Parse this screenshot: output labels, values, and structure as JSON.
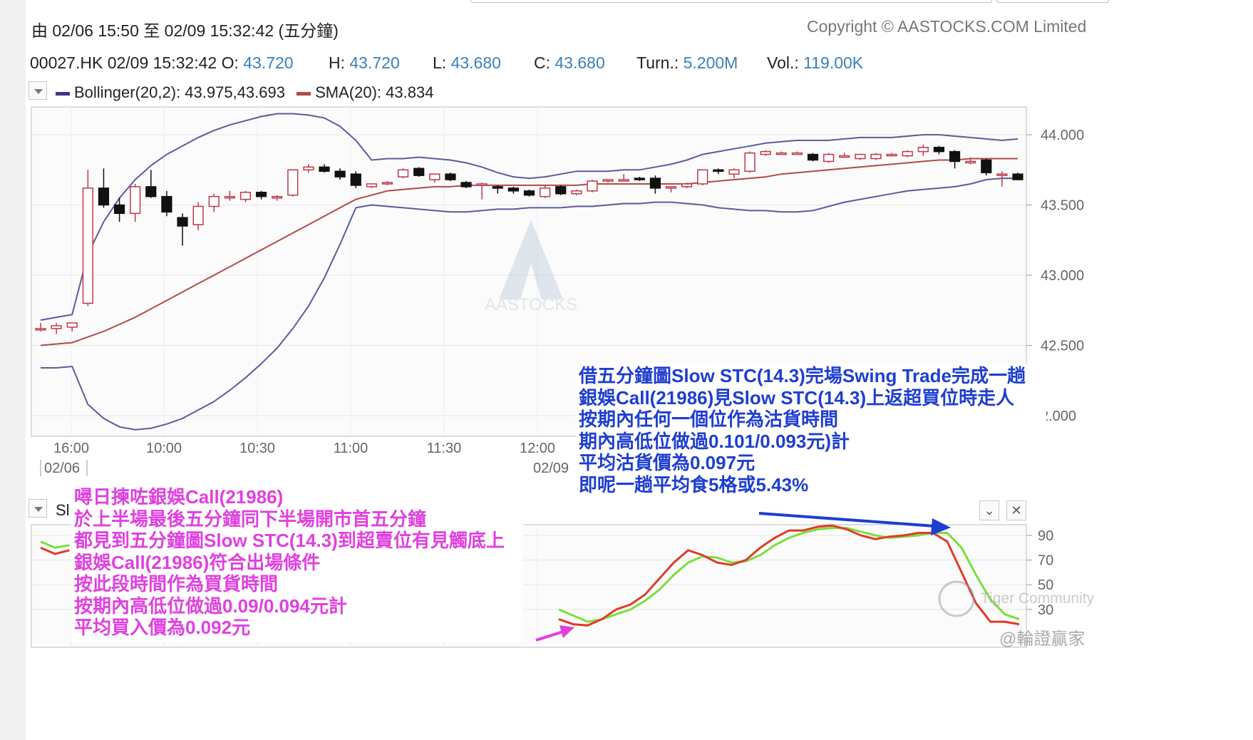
{
  "header": {
    "period": "由  02/06 15:50 至  02/09 15:32:42 (五分鐘)",
    "copyright": "Copyright © AASTOCKS.COM Limited"
  },
  "quote": {
    "symbol_time": "00027.HK 02/09 15:32:42",
    "o_label": "O:",
    "o_value": "43.720",
    "h_label": "H:",
    "h_value": "43.720",
    "l_label": "L:",
    "l_value": "43.680",
    "c_label": "C:",
    "c_value": "43.680",
    "turn_label": "Turn.:",
    "turn_value": "5.200M",
    "vol_label": "Vol.:",
    "vol_value": "119.00K"
  },
  "legend": {
    "bollinger": "Bollinger(20,2): 43.975,43.693",
    "sma": "SMA(20): 43.834"
  },
  "lower_panel": {
    "label_partial": "Sl"
  },
  "watermark": {
    "logo_text": "AASTOCKS",
    "tiger": "Tiger Community",
    "signature": "@輪證贏家"
  },
  "colors": {
    "bollinger": "#5b5b9e",
    "sma": "#b24a4a",
    "candle_up": "#c0384a",
    "candle_down": "#111111",
    "stc_k": "#e03a2a",
    "stc_d": "#7be03a",
    "annot_blue": "#1e3ecf",
    "annot_pink": "#e040e0",
    "arrow_blue": "#1e3ecf",
    "arrow_pink": "#e040e0"
  },
  "annotations": {
    "blue": [
      "借五分鐘圖Slow STC(14.3)完場Swing Trade完成一趟",
      "銀娛Call(21986)見Slow STC(14.3)上返超買位時走人",
      "按期內任何一個位作為沽貨時間",
      "期內高低位做過0.101/0.093元)計",
      "平均沽貨價為0.097元",
      "即呢一趟平均食5格或5.43%"
    ],
    "pink": [
      "噚日揀咗銀娛Call(21986)",
      "於上半場最後五分鐘同下半場開市首五分鐘",
      "都見到五分鐘圖Slow STC(14.3)到超賣位有見觸底上",
      "銀娛Call(21986)符合出場條件",
      "按此段時間作為買貨時間",
      "按期內高低位做過0.09/0.094元計",
      "平均買入價為0.092元"
    ]
  },
  "chart_data": [
    {
      "type": "candlestick",
      "title": "",
      "y_ticks": [
        "44.000",
        "43.500",
        "43.000",
        "42.500",
        "2.000"
      ],
      "ylim": [
        42.0,
        44.2
      ],
      "x_ticks": [
        "16:00",
        "10:00",
        "10:30",
        "11:00",
        "11:30",
        "12:00"
      ],
      "date_labels": [
        "02/06",
        "02/09"
      ],
      "grid": true,
      "candles": [
        {
          "o": 42.62,
          "h": 42.66,
          "l": 42.6,
          "c": 42.62
        },
        {
          "o": 42.62,
          "h": 42.66,
          "l": 42.58,
          "c": 42.64
        },
        {
          "o": 42.63,
          "h": 42.66,
          "l": 42.6,
          "c": 42.66
        },
        {
          "o": 42.8,
          "h": 43.75,
          "l": 42.78,
          "c": 43.62
        },
        {
          "o": 43.62,
          "h": 43.76,
          "l": 43.48,
          "c": 43.5
        },
        {
          "o": 43.5,
          "h": 43.55,
          "l": 43.38,
          "c": 43.44
        },
        {
          "o": 43.44,
          "h": 43.65,
          "l": 43.38,
          "c": 43.63
        },
        {
          "o": 43.63,
          "h": 43.75,
          "l": 43.55,
          "c": 43.56
        },
        {
          "o": 43.56,
          "h": 43.6,
          "l": 43.42,
          "c": 43.45
        },
        {
          "o": 43.41,
          "h": 43.44,
          "l": 43.21,
          "c": 43.35
        },
        {
          "o": 43.36,
          "h": 43.52,
          "l": 43.32,
          "c": 43.49
        },
        {
          "o": 43.49,
          "h": 43.58,
          "l": 43.45,
          "c": 43.56
        },
        {
          "o": 43.56,
          "h": 43.6,
          "l": 43.53,
          "c": 43.56
        },
        {
          "o": 43.54,
          "h": 43.6,
          "l": 43.52,
          "c": 43.59
        },
        {
          "o": 43.59,
          "h": 43.6,
          "l": 43.54,
          "c": 43.56
        },
        {
          "o": 43.56,
          "h": 43.57,
          "l": 43.53,
          "c": 43.56
        },
        {
          "o": 43.57,
          "h": 43.75,
          "l": 43.56,
          "c": 43.75
        },
        {
          "o": 43.75,
          "h": 43.79,
          "l": 43.73,
          "c": 43.77
        },
        {
          "o": 43.77,
          "h": 43.79,
          "l": 43.73,
          "c": 43.74
        },
        {
          "o": 43.74,
          "h": 43.76,
          "l": 43.68,
          "c": 43.7
        },
        {
          "o": 43.72,
          "h": 43.74,
          "l": 43.62,
          "c": 43.64
        },
        {
          "o": 43.63,
          "h": 43.65,
          "l": 43.62,
          "c": 43.65
        },
        {
          "o": 43.66,
          "h": 43.67,
          "l": 43.64,
          "c": 43.66
        },
        {
          "o": 43.7,
          "h": 43.76,
          "l": 43.69,
          "c": 43.75
        },
        {
          "o": 43.76,
          "h": 43.77,
          "l": 43.7,
          "c": 43.71
        },
        {
          "o": 43.68,
          "h": 43.72,
          "l": 43.66,
          "c": 43.72
        },
        {
          "o": 43.72,
          "h": 43.73,
          "l": 43.67,
          "c": 43.68
        },
        {
          "o": 43.66,
          "h": 43.67,
          "l": 43.62,
          "c": 43.63
        },
        {
          "o": 43.64,
          "h": 43.66,
          "l": 43.54,
          "c": 43.65
        },
        {
          "o": 43.63,
          "h": 43.64,
          "l": 43.58,
          "c": 43.62
        },
        {
          "o": 43.62,
          "h": 43.63,
          "l": 43.58,
          "c": 43.6
        },
        {
          "o": 43.6,
          "h": 43.61,
          "l": 43.56,
          "c": 43.57
        },
        {
          "o": 43.56,
          "h": 43.64,
          "l": 43.55,
          "c": 43.62
        },
        {
          "o": 43.63,
          "h": 43.64,
          "l": 43.57,
          "c": 43.58
        },
        {
          "o": 43.58,
          "h": 43.61,
          "l": 43.57,
          "c": 43.6
        },
        {
          "o": 43.6,
          "h": 43.68,
          "l": 43.59,
          "c": 43.67
        },
        {
          "o": 43.67,
          "h": 43.68,
          "l": 43.66,
          "c": 43.68
        },
        {
          "o": 43.68,
          "h": 43.72,
          "l": 43.67,
          "c": 43.68
        },
        {
          "o": 43.69,
          "h": 43.7,
          "l": 43.67,
          "c": 43.68
        },
        {
          "o": 43.69,
          "h": 43.71,
          "l": 43.58,
          "c": 43.62
        },
        {
          "o": 43.62,
          "h": 43.63,
          "l": 43.59,
          "c": 43.63
        },
        {
          "o": 43.63,
          "h": 43.66,
          "l": 43.62,
          "c": 43.65
        },
        {
          "o": 43.65,
          "h": 43.75,
          "l": 43.64,
          "c": 43.75
        },
        {
          "o": 43.75,
          "h": 43.76,
          "l": 43.72,
          "c": 43.74
        },
        {
          "o": 43.72,
          "h": 43.76,
          "l": 43.69,
          "c": 43.75
        },
        {
          "o": 43.74,
          "h": 43.88,
          "l": 43.73,
          "c": 43.87
        },
        {
          "o": 43.86,
          "h": 43.89,
          "l": 43.85,
          "c": 43.88
        },
        {
          "o": 43.87,
          "h": 43.88,
          "l": 43.86,
          "c": 43.87
        },
        {
          "o": 43.87,
          "h": 43.88,
          "l": 43.86,
          "c": 43.87
        },
        {
          "o": 43.86,
          "h": 43.87,
          "l": 43.81,
          "c": 43.82
        },
        {
          "o": 43.81,
          "h": 43.87,
          "l": 43.8,
          "c": 43.86
        },
        {
          "o": 43.85,
          "h": 43.87,
          "l": 43.84,
          "c": 43.85
        },
        {
          "o": 43.83,
          "h": 43.86,
          "l": 43.82,
          "c": 43.86
        },
        {
          "o": 43.83,
          "h": 43.87,
          "l": 43.82,
          "c": 43.86
        },
        {
          "o": 43.86,
          "h": 43.87,
          "l": 43.85,
          "c": 43.86
        },
        {
          "o": 43.85,
          "h": 43.89,
          "l": 43.84,
          "c": 43.88
        },
        {
          "o": 43.88,
          "h": 43.93,
          "l": 43.85,
          "c": 43.91
        },
        {
          "o": 43.91,
          "h": 43.92,
          "l": 43.86,
          "c": 43.88
        },
        {
          "o": 43.88,
          "h": 43.89,
          "l": 43.76,
          "c": 43.81
        },
        {
          "o": 43.8,
          "h": 43.84,
          "l": 43.79,
          "c": 43.81
        },
        {
          "o": 43.82,
          "h": 43.83,
          "l": 43.71,
          "c": 43.73
        },
        {
          "o": 43.72,
          "h": 43.74,
          "l": 43.63,
          "c": 43.72
        },
        {
          "o": 43.72,
          "h": 43.73,
          "l": 43.68,
          "c": 43.68
        }
      ],
      "bollinger_upper": [
        42.68,
        42.7,
        42.72,
        43.15,
        43.38,
        43.55,
        43.68,
        43.78,
        43.86,
        43.92,
        43.98,
        44.03,
        44.07,
        44.1,
        44.13,
        44.15,
        44.15,
        44.14,
        44.12,
        44.06,
        43.96,
        43.82,
        43.83,
        43.83,
        43.84,
        43.83,
        43.82,
        43.8,
        43.77,
        43.73,
        43.7,
        43.69,
        43.7,
        43.72,
        43.74,
        43.74,
        43.74,
        43.75,
        43.75,
        43.77,
        43.79,
        43.82,
        43.86,
        43.88,
        43.9,
        43.92,
        43.94,
        43.95,
        43.96,
        43.96,
        43.96,
        43.97,
        43.98,
        43.98,
        43.98,
        43.99,
        44.0,
        44.0,
        43.99,
        43.98,
        43.97,
        43.96,
        43.97
      ],
      "sma": [
        42.5,
        42.51,
        42.52,
        42.56,
        42.6,
        42.65,
        42.7,
        42.76,
        42.82,
        42.88,
        42.94,
        43.0,
        43.06,
        43.12,
        43.18,
        43.24,
        43.3,
        43.36,
        43.42,
        43.48,
        43.54,
        43.57,
        43.6,
        43.61,
        43.62,
        43.63,
        43.63,
        43.64,
        43.64,
        43.64,
        43.64,
        43.64,
        43.64,
        43.64,
        43.64,
        43.65,
        43.65,
        43.65,
        43.65,
        43.65,
        43.65,
        43.65,
        43.66,
        43.67,
        43.68,
        43.69,
        43.7,
        43.72,
        43.73,
        43.74,
        43.75,
        43.76,
        43.77,
        43.78,
        43.79,
        43.8,
        43.81,
        43.82,
        43.82,
        43.83,
        43.83,
        43.83,
        43.83
      ],
      "bollinger_lower": [
        42.34,
        42.34,
        42.35,
        42.08,
        41.98,
        41.92,
        41.9,
        41.91,
        41.94,
        41.98,
        42.04,
        42.1,
        42.18,
        42.27,
        42.37,
        42.48,
        42.62,
        42.78,
        42.98,
        43.22,
        43.48,
        43.5,
        43.49,
        43.48,
        43.47,
        43.46,
        43.45,
        43.45,
        43.46,
        43.47,
        43.47,
        43.48,
        43.48,
        43.48,
        43.49,
        43.49,
        43.5,
        43.51,
        43.51,
        43.52,
        43.52,
        43.51,
        43.5,
        43.48,
        43.47,
        43.46,
        43.46,
        43.45,
        43.45,
        43.46,
        43.49,
        43.52,
        43.54,
        43.56,
        43.58,
        43.6,
        43.61,
        43.62,
        43.63,
        43.65,
        43.68,
        43.69,
        43.69
      ]
    },
    {
      "type": "line",
      "title": "",
      "y_ticks": [
        "90",
        "70",
        "50",
        "30"
      ],
      "ylim": [
        0,
        100
      ],
      "grid": true,
      "series": [
        {
          "values": [
            80,
            75,
            78,
            null,
            null,
            null,
            null,
            null,
            null,
            null,
            null,
            null,
            null,
            null,
            null,
            null,
            null,
            null,
            null,
            null,
            null,
            null,
            null,
            null,
            null,
            null,
            null,
            null,
            null,
            null,
            null,
            null,
            null,
            null,
            null,
            null,
            22,
            18,
            17,
            22,
            30,
            34,
            42,
            55,
            68,
            78,
            74,
            68,
            66,
            70,
            80,
            88,
            94,
            94,
            97,
            98,
            95,
            90,
            87,
            89,
            90,
            92,
            92,
            85,
            60,
            35,
            20,
            20,
            18
          ]
        },
        {
          "values": [
            85,
            80,
            82,
            null,
            null,
            null,
            null,
            null,
            null,
            null,
            null,
            null,
            null,
            null,
            null,
            null,
            null,
            null,
            null,
            null,
            null,
            null,
            null,
            null,
            null,
            null,
            null,
            null,
            null,
            null,
            null,
            null,
            null,
            null,
            null,
            null,
            30,
            25,
            20,
            22,
            26,
            30,
            37,
            46,
            58,
            68,
            73,
            72,
            68,
            69,
            74,
            82,
            88,
            92,
            95,
            96,
            96,
            93,
            90,
            88,
            89,
            90,
            92,
            92,
            80,
            58,
            38,
            26,
            22
          ]
        }
      ]
    }
  ]
}
